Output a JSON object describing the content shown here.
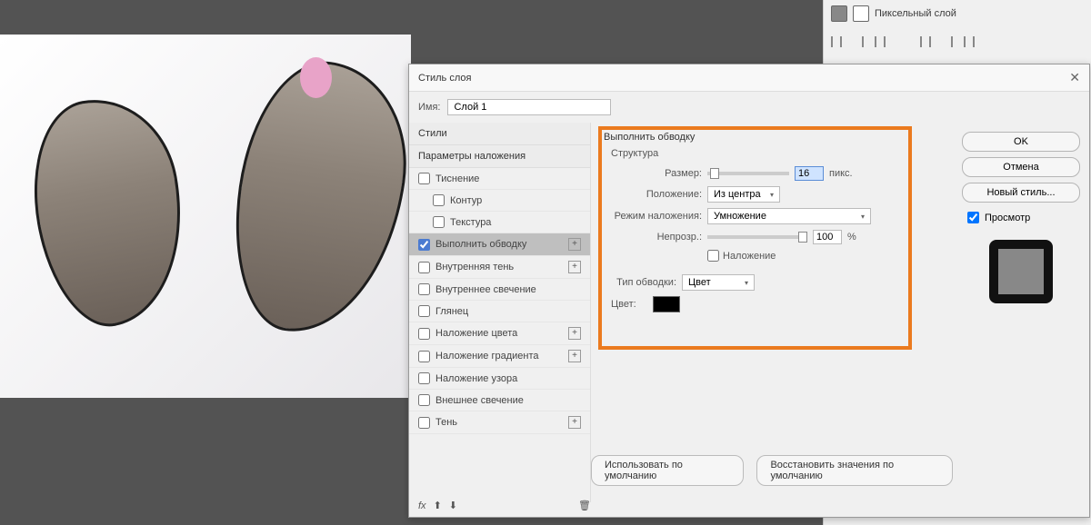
{
  "layers_panel": {
    "layer_name": "Пиксельный слой"
  },
  "dialog": {
    "title": "Стиль слоя",
    "name_label": "Имя:",
    "name_value": "Слой 1",
    "styles_header": "Стили",
    "params_header": "Параметры наложения",
    "style_items": [
      {
        "label": "Тиснение",
        "checked": false,
        "indent": false,
        "plus": false,
        "selected": false
      },
      {
        "label": "Контур",
        "checked": false,
        "indent": true,
        "plus": false,
        "selected": false
      },
      {
        "label": "Текстура",
        "checked": false,
        "indent": true,
        "plus": false,
        "selected": false
      },
      {
        "label": "Выполнить обводку",
        "checked": true,
        "indent": false,
        "plus": true,
        "selected": true
      },
      {
        "label": "Внутренняя тень",
        "checked": false,
        "indent": false,
        "plus": true,
        "selected": false
      },
      {
        "label": "Внутреннее свечение",
        "checked": false,
        "indent": false,
        "plus": false,
        "selected": false
      },
      {
        "label": "Глянец",
        "checked": false,
        "indent": false,
        "plus": false,
        "selected": false
      },
      {
        "label": "Наложение цвета",
        "checked": false,
        "indent": false,
        "plus": true,
        "selected": false
      },
      {
        "label": "Наложение градиента",
        "checked": false,
        "indent": false,
        "plus": true,
        "selected": false
      },
      {
        "label": "Наложение узора",
        "checked": false,
        "indent": false,
        "plus": false,
        "selected": false
      },
      {
        "label": "Внешнее свечение",
        "checked": false,
        "indent": false,
        "plus": false,
        "selected": false
      },
      {
        "label": "Тень",
        "checked": false,
        "indent": false,
        "plus": true,
        "selected": false
      }
    ],
    "content": {
      "section_title": "Выполнить обводку",
      "structure_title": "Структура",
      "size_label": "Размер:",
      "size_value": "16",
      "size_unit": "пикс.",
      "position_label": "Положение:",
      "position_value": "Из центра",
      "blend_label": "Режим наложения:",
      "blend_value": "Умножение",
      "opacity_label": "Непрозр.:",
      "opacity_value": "100",
      "opacity_unit": "%",
      "overlay_chk": "Наложение",
      "type_label": "Тип обводки:",
      "type_value": "Цвет",
      "color_label": "Цвет:",
      "use_default": "Использовать по умолчанию",
      "reset_default": "Восстановить значения по умолчанию"
    },
    "buttons": {
      "ok": "OK",
      "cancel": "Отмена",
      "new_style": "Новый стиль...",
      "preview": "Просмотр"
    },
    "footer_fx": "fx"
  }
}
